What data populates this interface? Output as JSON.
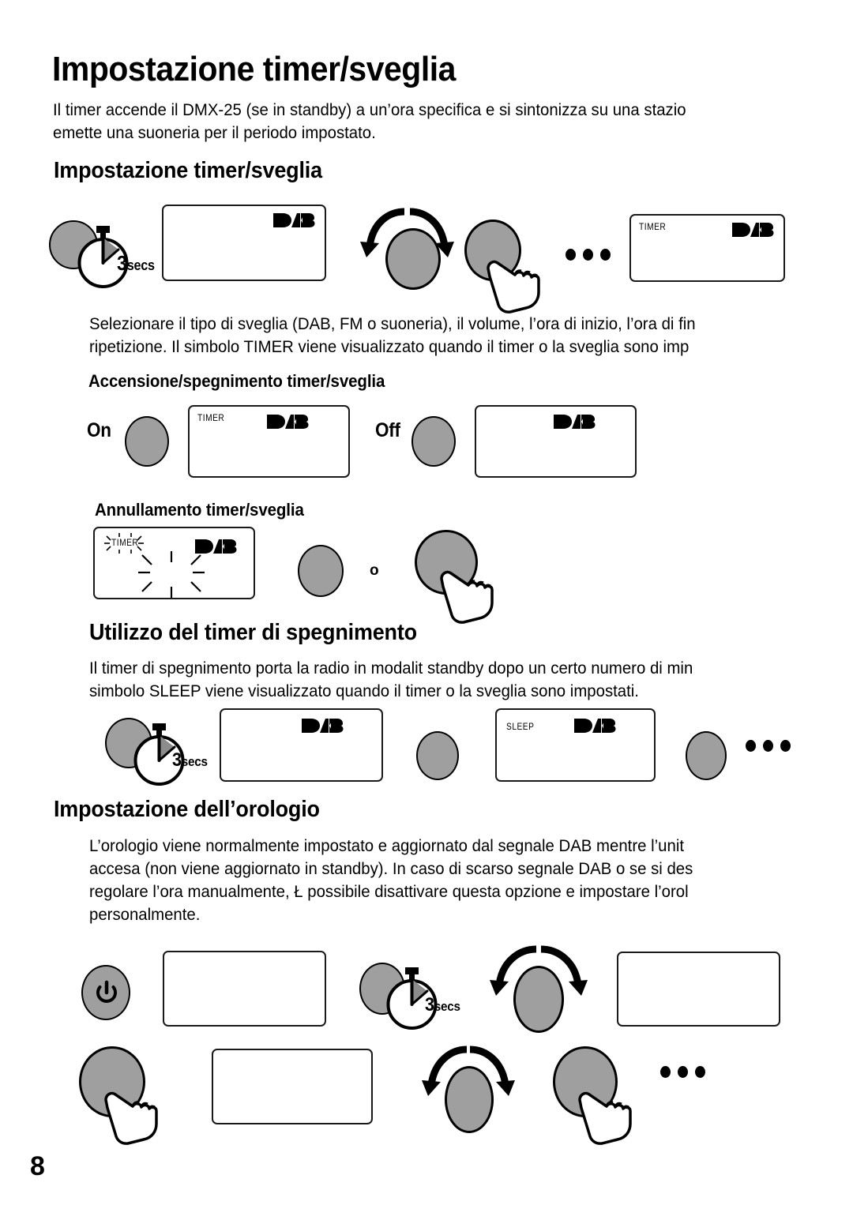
{
  "page": {
    "number": "8",
    "language": "it"
  },
  "title": "Impostazione timer/sveglia",
  "intro": {
    "line1": "Il timer accende il DMX-25 (se in standby) a un’ora specifica e si sintonizza su una stazio",
    "line2": "emette una suoneria per il periodo impostato."
  },
  "sections": [
    {
      "heading": "Impostazione timer/sveglia",
      "body": {
        "line1": "Selezionare il tipo di sveglia (DAB, FM o suoneria), il volume, l’ora di inizio, l’ora di fin",
        "line2": "ripetizione. Il simbolo TIMER viene visualizzato quando il timer o la sveglia sono imp"
      },
      "subsections": [
        {
          "heading": "Accensione/spegnimento timer/sveglia"
        },
        {
          "heading": "Annullamento timer/sveglia"
        }
      ]
    },
    {
      "heading": "Utilizzo del timer di spegnimento",
      "body": {
        "line1": "Il timer di spegnimento porta la radio in modalit  standby dopo un certo numero di min",
        "line2": "simbolo SLEEP viene visualizzato quando il timer o la sveglia sono impostati."
      }
    },
    {
      "heading": "Impostazione dell’orologio",
      "body": {
        "line1": "L’orologio viene normalmente impostato e aggiornato dal segnale DAB mentre l’unit",
        "line2": "accesa (non viene aggiornato in standby). In caso di scarso segnale DAB o se si des",
        "line3": "regolare l’ora manualmente, Ł possibile disattivare questa opzione e impostare l’orol",
        "line4": "personalmente."
      }
    }
  ],
  "labels": {
    "secs": "3secs",
    "secs_number": "3",
    "secs_unit": "secs",
    "on": "On",
    "off": "Off",
    "or": "o"
  },
  "display_tags": {
    "timer": "TIMER",
    "sleep": "SLEEP",
    "dab": "DAB"
  },
  "icons": {
    "power": "power-icon",
    "stopwatch": "stopwatch-icon",
    "hand": "pointing-hand-icon",
    "rotate": "rotate-knob-arrows-icon",
    "ellipsis": "ellipsis-dots-icon",
    "dab_logo": "dab-logo-icon",
    "blink": "blinking-indicator-icon"
  },
  "colors": {
    "knob_fill": "#9f9f9f",
    "outline": "#000000",
    "page_bg": "#ffffff",
    "text": "#000000"
  },
  "diagrams": [
    {
      "name": "timer-alarm-setup-steps",
      "steps": [
        "press-and-hold-3secs",
        "display-blank",
        "rotate-knob",
        "press-knob",
        "ellipsis",
        "display-timer"
      ]
    },
    {
      "name": "timer-alarm-on-off",
      "steps": [
        "on-knob",
        "display-timer",
        "off-knob",
        "display-blank"
      ]
    },
    {
      "name": "timer-alarm-cancel",
      "steps": [
        "display-timer-blinking",
        "knob",
        "or",
        "press-knob"
      ]
    },
    {
      "name": "sleep-timer-steps",
      "steps": [
        "press-and-hold-3secs",
        "display-blank",
        "knob",
        "display-sleep",
        "knob",
        "ellipsis"
      ]
    },
    {
      "name": "clock-setting-steps-row1",
      "steps": [
        "power-knob",
        "display-blank",
        "press-and-hold-3secs",
        "rotate-knob",
        "display-blank"
      ]
    },
    {
      "name": "clock-setting-steps-row2",
      "steps": [
        "press-knob",
        "display-blank",
        "rotate-knob",
        "press-knob",
        "ellipsis"
      ]
    }
  ]
}
